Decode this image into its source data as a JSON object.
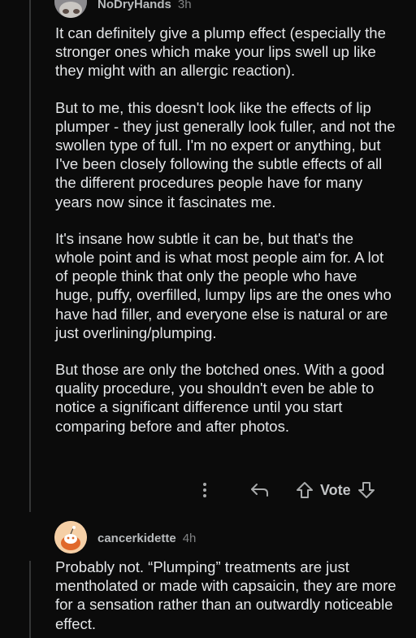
{
  "comments": [
    {
      "author": "NoDryHands",
      "time": "3h",
      "paragraphs": [
        "It can definitely give a plump effect (especially the stronger ones which make your lips swell up like they might with an allergic reaction).",
        "But to me, this doesn't look like the effects of lip plumper - they just generally look fuller, and not the swollen type of full. I'm no expert or anything, but I've been closely following the subtle effects of all the different procedures people have for many years now since it fascinates me.",
        "It's insane how subtle it can be, but that's the whole point and is what most people aim for. A lot of people think that only the people who have huge, puffy, overfilled, lumpy lips are the ones who have had filler, and everyone else is natural or are just overlining/plumping.",
        "But those are only the botched ones. With a good quality procedure, you shouldn't even be able to notice a significant difference until you start comparing before and after photos."
      ],
      "actions": {
        "more_icon": "more-vertical-icon",
        "reply_icon": "reply-arrow-icon",
        "upvote_icon": "upvote-arrow-icon",
        "vote_label": "Vote",
        "downvote_icon": "downvote-arrow-icon"
      }
    },
    {
      "author": "cancerkidette",
      "time": "4h",
      "paragraphs": [
        "Probably not. “Plumping” treatments are just mentholated or made with capsaicin, they are more for a sensation rather than an outwardly noticeable effect."
      ]
    }
  ]
}
